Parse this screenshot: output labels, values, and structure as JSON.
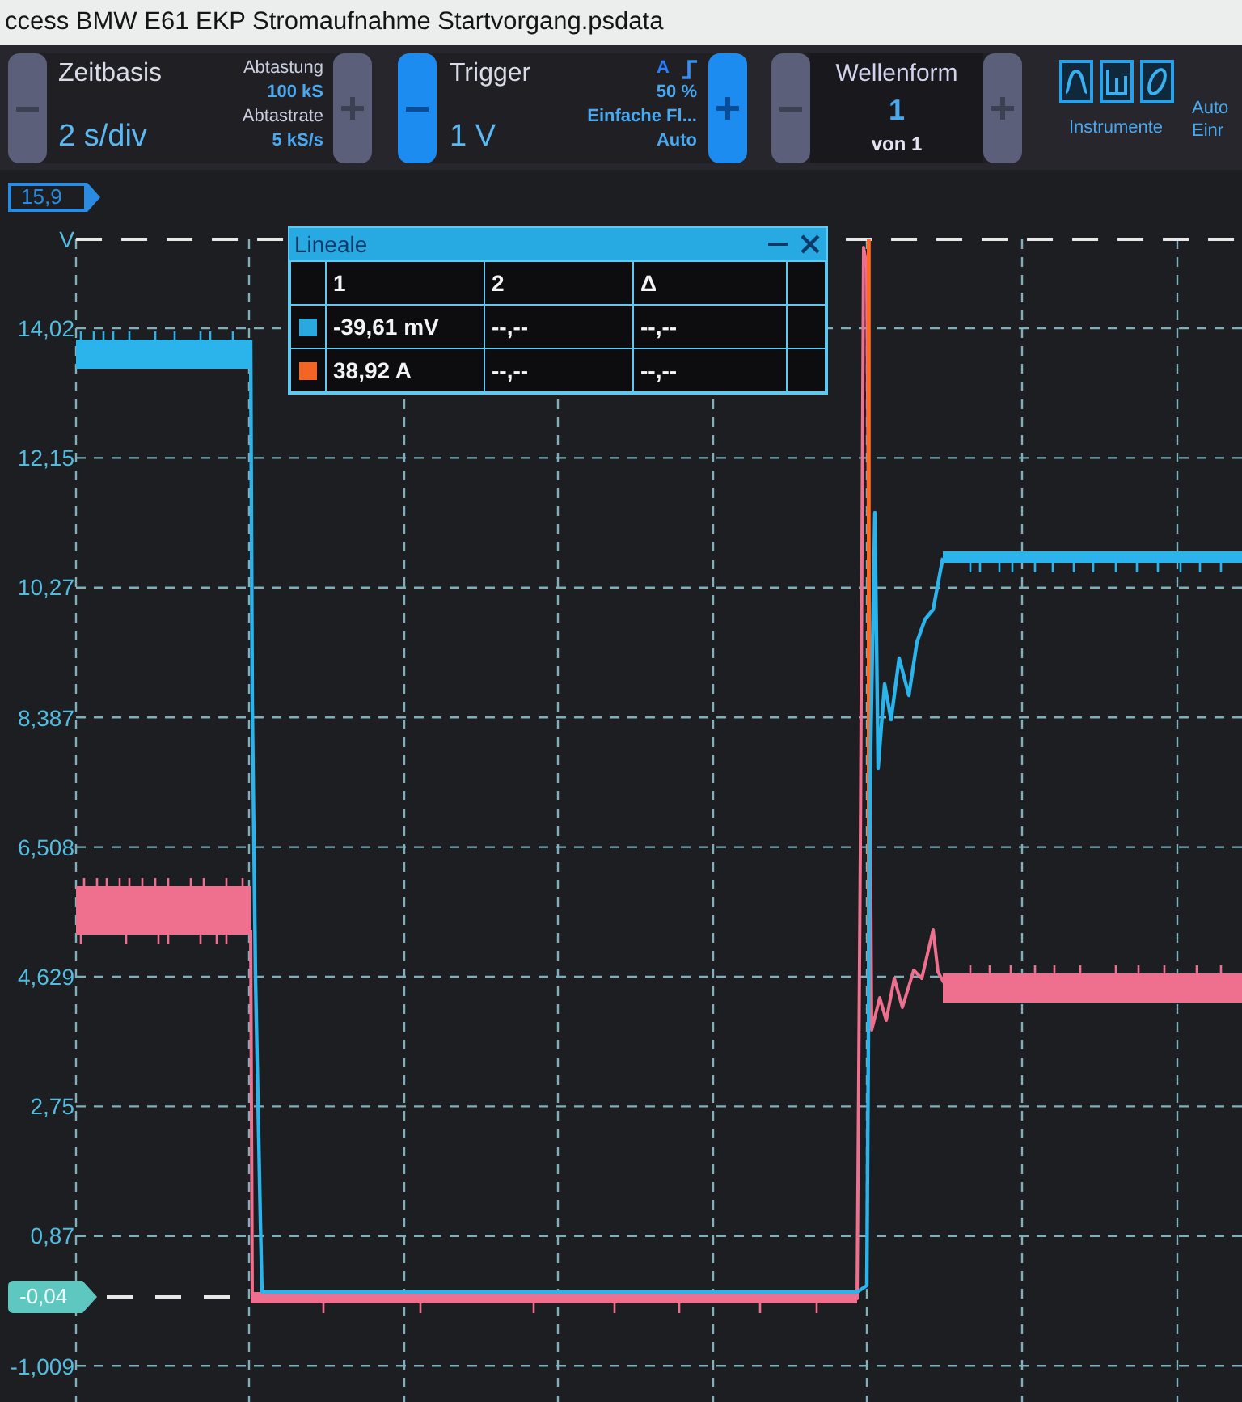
{
  "window": {
    "title": "ccess BMW E61 EKP Stromaufnahme Startvorgang.psdata"
  },
  "toolbar": {
    "timebase": {
      "label": "Zeitbasis",
      "value": "2 s/div",
      "minus": {
        "disabled": true
      },
      "plus": {
        "disabled": true
      },
      "details": [
        {
          "label": "Abtastung",
          "value": "100 kS"
        },
        {
          "label": "Abtastrate",
          "value": "5 kS/s"
        }
      ]
    },
    "trigger": {
      "label": "Trigger",
      "value": "1 V",
      "channel": "A",
      "threshold": "50 %",
      "type": "Einfache Fl...",
      "mode": "Auto",
      "minus": {
        "disabled": false
      },
      "plus": {
        "disabled": false
      }
    },
    "waveform": {
      "label": "Wellenform",
      "value": "1",
      "count": "von 1",
      "minus": {
        "disabled": true
      },
      "plus": {
        "disabled": true
      }
    },
    "instruments": {
      "label": "Instrumente"
    },
    "auto_setup": {
      "lines": [
        "Auto",
        "Einr"
      ]
    }
  },
  "plot": {
    "top_marker": "15,9",
    "unit": "V",
    "y_ticks": [
      "14,02",
      "12,15",
      "10,27",
      "8,387",
      "6,508",
      "4,629",
      "2,75",
      "0,87",
      "-1,009"
    ],
    "offset_marker": "-0,04",
    "traces": [
      {
        "color": "#2bb3ec"
      },
      {
        "color": "#ee6f8e"
      }
    ]
  },
  "rulers_panel": {
    "title": "Lineale",
    "columns": [
      "1",
      "2",
      "Δ"
    ],
    "rows": [
      {
        "color": "#2aa8e0",
        "values": [
          "-39,61 mV",
          "--,--",
          "--,--"
        ]
      },
      {
        "color": "#f26522",
        "values": [
          "38,92 A",
          "--,--",
          "--,--"
        ]
      }
    ]
  }
}
